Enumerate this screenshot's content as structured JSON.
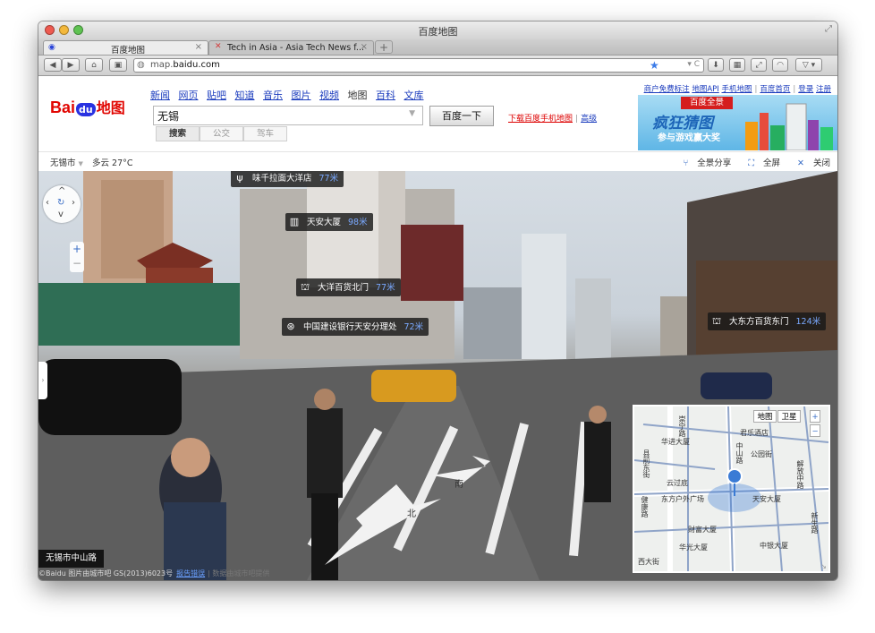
{
  "window": {
    "title": "百度地图"
  },
  "tabs": [
    {
      "label": "百度地图",
      "close": "×"
    },
    {
      "label": "Tech in Asia - Asia Tech News f...",
      "close": "×"
    }
  ],
  "tab_new": "+",
  "toolbar": {
    "url_host": "map.",
    "url_domain": "baidu.com"
  },
  "header": {
    "logo_bai": "Bai",
    "logo_du": "du",
    "logo_map": "地图",
    "nav": [
      "新闻",
      "网页",
      "贴吧",
      "知道",
      "音乐",
      "图片",
      "视频",
      "地图",
      "百科",
      "文库"
    ],
    "search_value": "无锡",
    "search_button": "百度一下",
    "modes": [
      "搜索",
      "公交",
      "驾车"
    ],
    "download_link": "下载百度手机地图",
    "advanced_link": "高级",
    "top_links": [
      "商户免费标注",
      "地图API",
      "手机地图",
      "百度首页",
      "登录",
      "注册"
    ]
  },
  "ad": {
    "badge": "百度全景",
    "headline": "疯狂猜图",
    "sub": "参与游戏赢大奖"
  },
  "infobar": {
    "city": "无锡市",
    "city_arrow": "▼",
    "weather": "多云 27°C",
    "share": "全景分享",
    "fullscreen": "全屏",
    "close": "关闭"
  },
  "pano": {
    "pois": [
      {
        "icon": "fork-knife-icon",
        "name": "味千拉面大洋店",
        "dist": "77米"
      },
      {
        "icon": "building-icon",
        "name": "天安大厦",
        "dist": "98米"
      },
      {
        "icon": "shopping-basket-icon",
        "name": "大洋百货北门",
        "dist": "77米"
      },
      {
        "icon": "bank-icon",
        "name": "中国建设银行天安分理处",
        "dist": "72米"
      },
      {
        "icon": "shopping-basket-icon",
        "name": "大东方百货东门",
        "dist": "124米"
      }
    ],
    "arrow_south": "南",
    "arrow_north": "北",
    "street": "无锡市中山路",
    "copyright": "©Baidu 图片由城市吧 GS(2013)6023号",
    "report": "报告错误",
    "report_suffix": "| 数据由城市吧提供"
  },
  "minimap": {
    "btn_map": "地图",
    "btn_satellite": "卫星",
    "labels": [
      "华进大厦",
      "君乐酒店",
      "公园街",
      "解放中路",
      "中山路",
      "云过底",
      "东方户外广场",
      "天安大厦",
      "健康路",
      "财富大厦",
      "华光大厦",
      "中银大厦",
      "新生路",
      "西大街",
      "崇宁路",
      "县前东街"
    ]
  }
}
